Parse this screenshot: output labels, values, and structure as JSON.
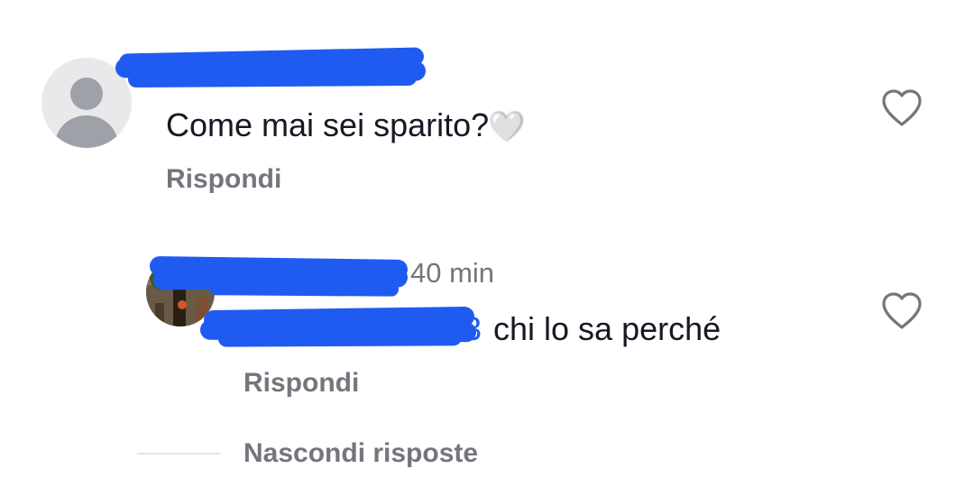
{
  "comment": {
    "text": "Come mai sei sparito?",
    "emoji": "🤍",
    "reply_label": "Rispondi"
  },
  "reply": {
    "time": "40 min",
    "mention_tail": "3",
    "text": "chi lo sa perché",
    "reply_label": "Rispondi"
  },
  "thread": {
    "hide_replies_label": "Nascondi risposte"
  },
  "colors": {
    "redaction": "#1f5bf0",
    "secondary_text": "#73767d",
    "primary_text": "#161823"
  }
}
